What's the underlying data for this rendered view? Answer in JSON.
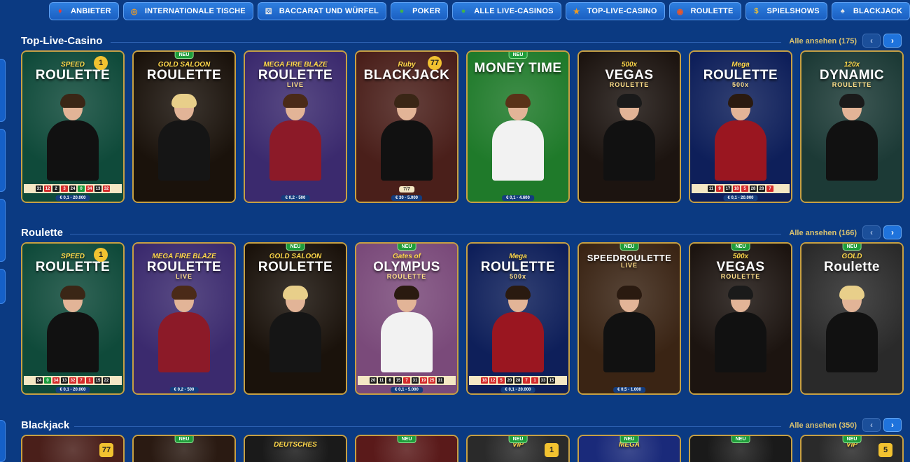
{
  "nav": [
    {
      "label": "ANBIETER",
      "icon": "cards-icon",
      "color": "#e23b3b"
    },
    {
      "label": "INTERNATIONALE TISCHE",
      "icon": "compass-icon",
      "color": "#f39c1f"
    },
    {
      "label": "BACCARAT UND WÜRFEL",
      "icon": "dice-icon",
      "color": "#e8e8e8"
    },
    {
      "label": "POKER",
      "icon": "chips-icon",
      "color": "#3fb24a"
    },
    {
      "label": "ALLE LIVE-CASINOS",
      "icon": "chips-icon",
      "color": "#3fb24a"
    },
    {
      "label": "TOP-LIVE-CASINO",
      "icon": "star-icon",
      "color": "#f39c1f"
    },
    {
      "label": "ROULETTE",
      "icon": "roulette-icon",
      "color": "#e8562a"
    },
    {
      "label": "SPIELSHOWS",
      "icon": "coins-icon",
      "color": "#f2c230"
    },
    {
      "label": "BLACKJACK",
      "icon": "blackjack-icon",
      "color": "#e8e8e8"
    }
  ],
  "sections": [
    {
      "title": "Top-Live-Casino",
      "see_all": "Alle ansehen (175)",
      "cards": [
        {
          "small": "SPEED",
          "big": "ROULETTE",
          "sub": "",
          "badge": "1",
          "neu": false,
          "bg": "#0f4a3a",
          "hair": "#3a2616",
          "body": "#111",
          "numbers": [
            [
              "31",
              "b"
            ],
            [
              "12",
              "r"
            ],
            [
              "2",
              "b"
            ],
            [
              "3",
              "r"
            ],
            [
              "24",
              "b"
            ],
            [
              "0",
              "g"
            ],
            [
              "34",
              "r"
            ],
            [
              "13",
              "b"
            ],
            [
              "32",
              "r"
            ]
          ],
          "limits": "€ 0,1 - 20.000"
        },
        {
          "small": "GOLD SALOON",
          "big": "ROULETTE",
          "sub": "",
          "badge": "",
          "neu": true,
          "bg": "#1a120b",
          "hair": "#e8cf8a",
          "body": "#151515",
          "numbers": [],
          "limits": ""
        },
        {
          "small": "MEGA FIRE BLAZE",
          "big": "ROULETTE",
          "sub": "LIVE",
          "badge": "",
          "neu": false,
          "bg": "#3b2a6e",
          "hair": "#4a2a18",
          "body": "#8c1a28",
          "numbers": [],
          "limits": "€ 0,2 - 500"
        },
        {
          "small": "Ruby",
          "big": "BLACKJACK",
          "sub": "",
          "badge": "77",
          "neu": false,
          "bg": "#4a1f1a",
          "hair": "#3a2616",
          "body": "#111",
          "numbers": [],
          "limits": "€ 30 - 5.000",
          "seats": "7/7"
        },
        {
          "small": "",
          "big": "MONEY TIME",
          "sub": "",
          "badge": "",
          "neu": true,
          "bg": "#1f7a2a",
          "hair": "#5a3218",
          "body": "#f2f2f2",
          "numbers": [],
          "limits": "€ 0,1 - 4.600"
        },
        {
          "small": "500x",
          "big": "VEGAS",
          "sub": "ROULETTE",
          "badge": "",
          "neu": false,
          "bg": "#1c1410",
          "hair": "#1a1a1a",
          "body": "#111",
          "numbers": [],
          "limits": ""
        },
        {
          "small": "Mega",
          "big": "ROULETTE",
          "sub": "500x",
          "badge": "",
          "neu": false,
          "bg": "#0e1f5a",
          "hair": "#2a1a10",
          "body": "#9a1620",
          "numbers": [
            [
              "11",
              "b"
            ],
            [
              "9",
              "r"
            ],
            [
              "17",
              "b"
            ],
            [
              "18",
              "r"
            ],
            [
              "5",
              "r"
            ],
            [
              "28",
              "b"
            ],
            [
              "28",
              "b"
            ],
            [
              "7",
              "r"
            ]
          ],
          "limits": "€ 0,1 - 20.000"
        },
        {
          "small": "120x",
          "big": "DYNAMIC",
          "sub": "ROULETTE",
          "badge": "",
          "neu": false,
          "bg": "#1c3a36",
          "hair": "#1a1a1a",
          "body": "#111",
          "numbers": [],
          "limits": ""
        }
      ]
    },
    {
      "title": "Roulette",
      "see_all": "Alle ansehen (166)",
      "cards": [
        {
          "small": "SPEED",
          "big": "ROULETTE",
          "sub": "",
          "badge": "1",
          "neu": false,
          "bg": "#0f4a3a",
          "hair": "#3a2616",
          "body": "#111",
          "numbers": [
            [
              "24",
              "b"
            ],
            [
              "0",
              "g"
            ],
            [
              "34",
              "r"
            ],
            [
              "13",
              "b"
            ],
            [
              "32",
              "r"
            ],
            [
              "7",
              "r"
            ],
            [
              "1",
              "r"
            ],
            [
              "15",
              "b"
            ],
            [
              "22",
              "b"
            ]
          ],
          "limits": "€ 0,1 - 20.000"
        },
        {
          "small": "MEGA FIRE BLAZE",
          "big": "ROULETTE",
          "sub": "LIVE",
          "badge": "",
          "neu": false,
          "bg": "#3b2a6e",
          "hair": "#4a2a18",
          "body": "#8c1a28",
          "numbers": [],
          "limits": "€ 0,2 - 500"
        },
        {
          "small": "GOLD SALOON",
          "big": "ROULETTE",
          "sub": "",
          "badge": "",
          "neu": true,
          "bg": "#1a120b",
          "hair": "#e8cf8a",
          "body": "#151515",
          "numbers": [],
          "limits": ""
        },
        {
          "small": "Gates of",
          "big": "OLYMPUS",
          "sub": "ROULETTE",
          "badge": "",
          "neu": true,
          "bg": "#7a4a7a",
          "hair": "#2a1a10",
          "body": "#f2f2f2",
          "numbers": [
            [
              "20",
              "b"
            ],
            [
              "11",
              "b"
            ],
            [
              "8",
              "b"
            ],
            [
              "15",
              "b"
            ],
            [
              "7",
              "r"
            ],
            [
              "31",
              "b"
            ],
            [
              "19",
              "r"
            ],
            [
              "25",
              "r"
            ],
            [
              "31",
              "b"
            ]
          ],
          "limits": "€ 0,1 - 5.000"
        },
        {
          "small": "Mega",
          "big": "ROULETTE",
          "sub": "500x",
          "badge": "",
          "neu": false,
          "bg": "#0e1f5a",
          "hair": "#2a1a10",
          "body": "#9a1620",
          "numbers": [
            [
              "18",
              "r"
            ],
            [
              "12",
              "r"
            ],
            [
              "5",
              "r"
            ],
            [
              "20",
              "b"
            ],
            [
              "28",
              "b"
            ],
            [
              "7",
              "r"
            ],
            [
              "1",
              "r"
            ],
            [
              "33",
              "b"
            ],
            [
              "15",
              "b"
            ]
          ],
          "limits": "€ 0,1 - 20.000"
        },
        {
          "small": "",
          "big": "SPEEDROULETTE",
          "sub": "LIVE",
          "badge": "",
          "neu": true,
          "bg": "#3a2414",
          "hair": "#2a1a10",
          "body": "#111",
          "numbers": [],
          "limits": "€ 0,5 - 1.000"
        },
        {
          "small": "500x",
          "big": "VEGAS",
          "sub": "ROULETTE",
          "badge": "",
          "neu": true,
          "bg": "#1c1410",
          "hair": "#1a1a1a",
          "body": "#111",
          "numbers": [],
          "limits": ""
        },
        {
          "small": "GOLD",
          "big": "Roulette",
          "sub": "",
          "badge": "",
          "neu": true,
          "bg": "#2a2a2a",
          "hair": "#e8cf8a",
          "body": "#111",
          "numbers": [],
          "limits": ""
        }
      ]
    },
    {
      "title": "Blackjack",
      "see_all": "Alle ansehen (350)",
      "cards": [
        {
          "small": "",
          "big": "",
          "sub": "",
          "badge": "77",
          "neu": false,
          "bg": "#4a1f1a"
        },
        {
          "small": "",
          "big": "",
          "sub": "",
          "badge": "",
          "neu": true,
          "bg": "#2a1a12"
        },
        {
          "small": "DEUTSCHES",
          "big": "",
          "sub": "",
          "badge": "",
          "neu": false,
          "bg": "#1a1a1a"
        },
        {
          "small": "",
          "big": "",
          "sub": "",
          "badge": "",
          "neu": true,
          "bg": "#5a1a1a"
        },
        {
          "small": "VIP",
          "big": "",
          "sub": "",
          "badge": "1",
          "neu": true,
          "bg": "#2a2a2a"
        },
        {
          "small": "MEGA",
          "big": "",
          "sub": "",
          "badge": "",
          "neu": true,
          "bg": "#1a2a7a"
        },
        {
          "small": "",
          "big": "",
          "sub": "",
          "badge": "",
          "neu": true,
          "bg": "#1a1a1a"
        },
        {
          "small": "VIP",
          "big": "",
          "sub": "",
          "badge": "5",
          "neu": true,
          "bg": "#2a2a2a"
        }
      ]
    }
  ],
  "neu_label": "NEU"
}
